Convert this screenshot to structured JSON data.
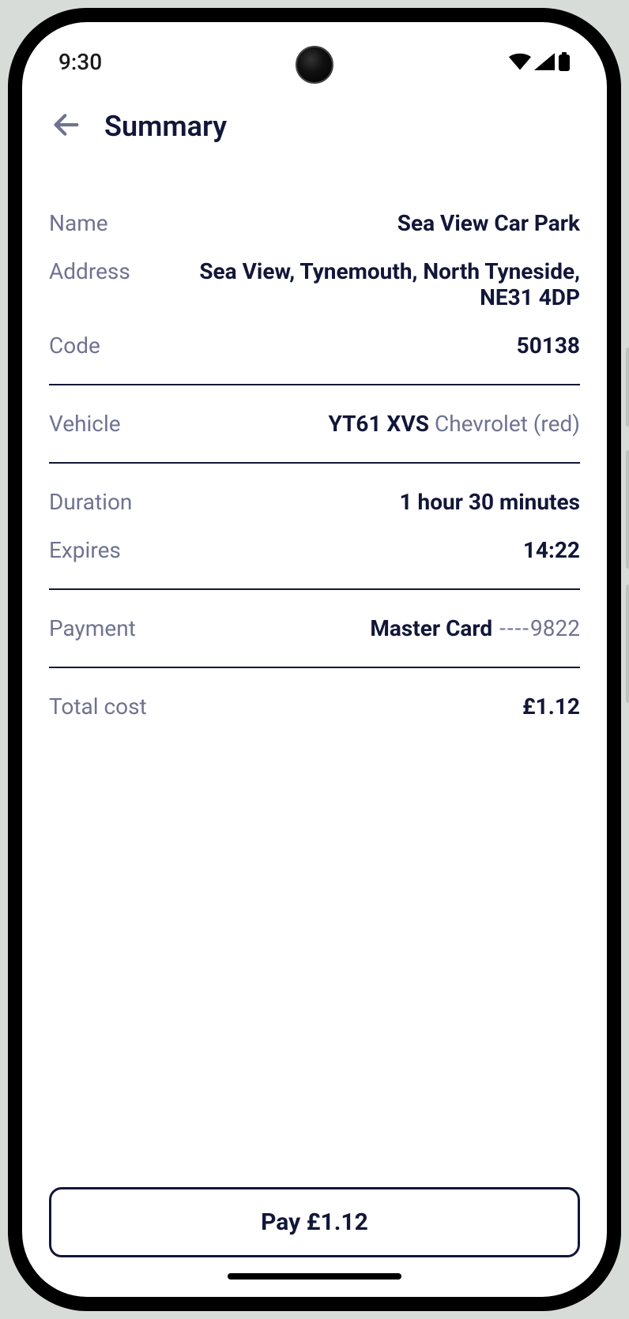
{
  "status": {
    "time": "9:30"
  },
  "header": {
    "title": "Summary"
  },
  "summary": {
    "name_label": "Name",
    "name_value": "Sea View Car Park",
    "address_label": "Address",
    "address_value": "Sea View, Tynemouth, North Tyneside, NE31 4DP",
    "code_label": "Code",
    "code_value": "50138",
    "vehicle_label": "Vehicle",
    "vehicle_plate": "YT61 XVS",
    "vehicle_desc": " Chevrolet (red)",
    "duration_label": "Duration",
    "duration_value": "1 hour 30 minutes",
    "expires_label": "Expires",
    "expires_value": "14:22",
    "payment_label": "Payment",
    "payment_card": "Master Card",
    "payment_mask": " ----",
    "payment_last": "9822",
    "total_label": "Total cost",
    "total_value": "£1.12"
  },
  "actions": {
    "pay_label": "Pay £1.12"
  }
}
